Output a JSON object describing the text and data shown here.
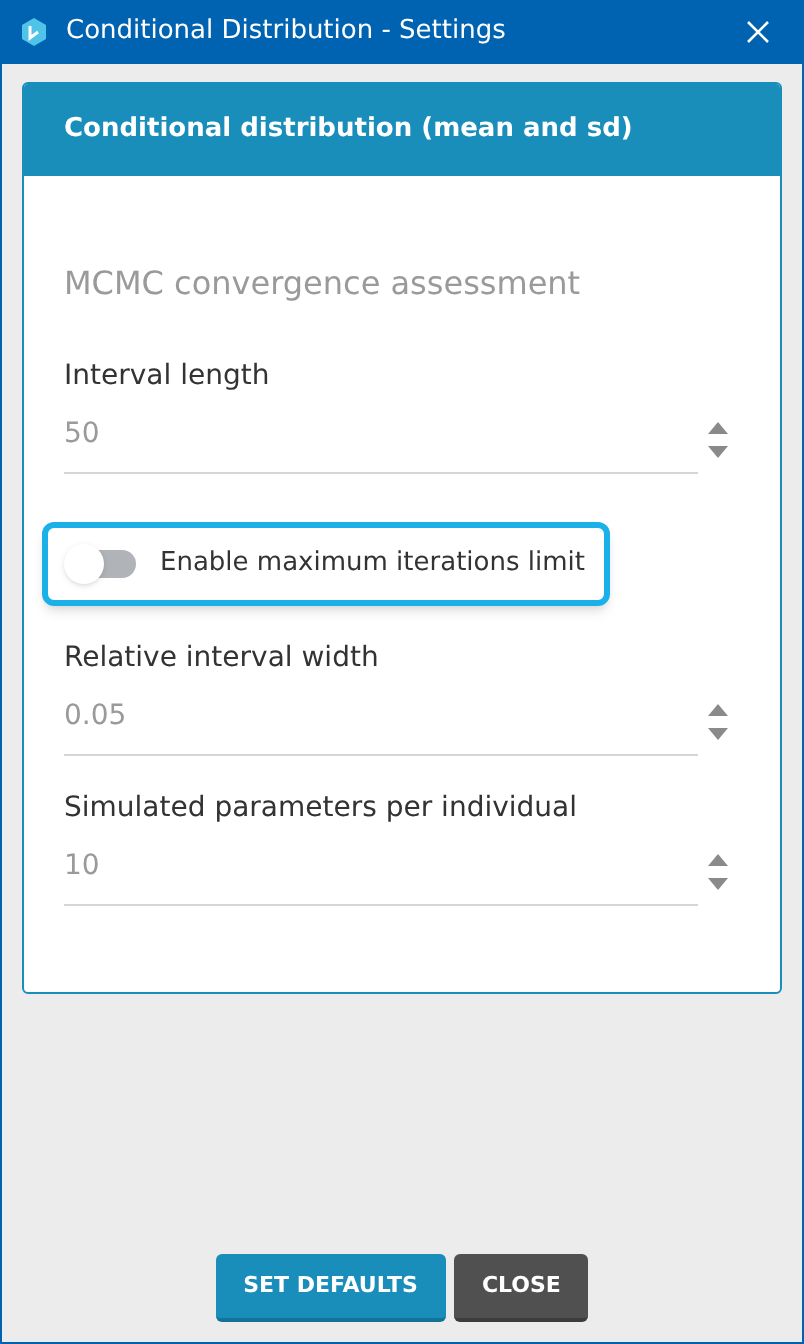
{
  "window": {
    "title": "Conditional Distribution - Settings"
  },
  "card": {
    "title": "Conditional distribution (mean and sd)",
    "section": "MCMC convergence assessment",
    "items": [
      {
        "kind": "number",
        "label": "Interval length",
        "value": "50"
      },
      {
        "kind": "toggle",
        "label": "Enable maximum iterations limit",
        "on": false,
        "focused": true
      },
      {
        "kind": "number",
        "label": "Relative interval width",
        "value": "0.05"
      },
      {
        "kind": "number",
        "label": "Simulated parameters per individual",
        "value": "10"
      }
    ]
  },
  "buttons": [
    {
      "label": "SET DEFAULTS",
      "kind": "primary"
    },
    {
      "label": "CLOSE",
      "kind": "secondary"
    }
  ]
}
